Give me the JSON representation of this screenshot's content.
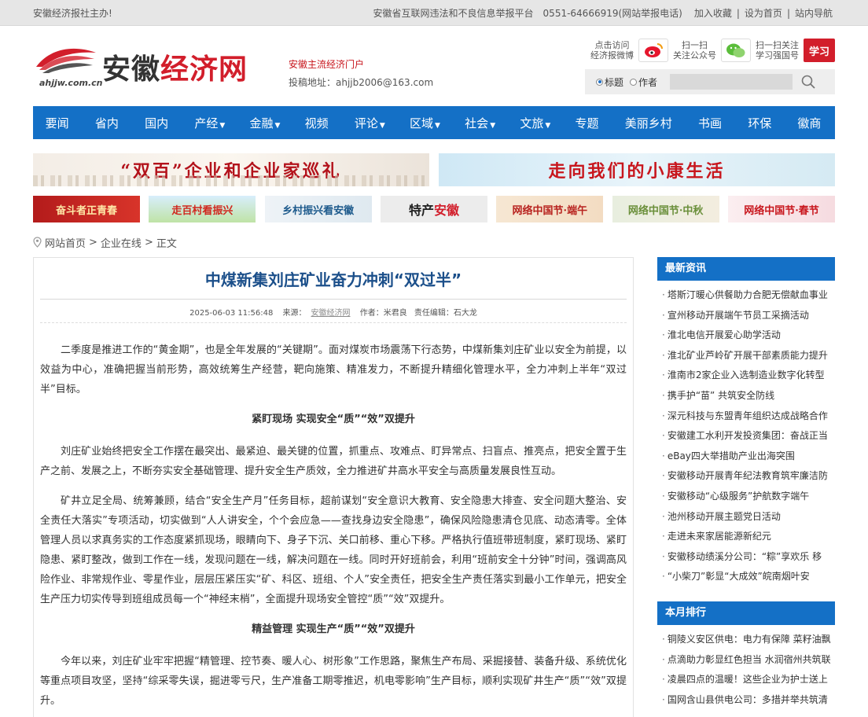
{
  "topbar": {
    "left": "安徽经济报社主办!",
    "report": "安徽省互联网违法和不良信息举报平台",
    "phone": "0551-64666919(网站举报电话)",
    "links": [
      "加入收藏",
      "|",
      "设为首页",
      "|",
      "站内导航"
    ]
  },
  "header": {
    "logo_name_1": "安徽",
    "logo_name_2": "经济网",
    "logo_domain": "ahjjw.com.cn",
    "tagline": "安徽主流经济门户",
    "email": "投稿地址：ahjjb2006@163.com",
    "weibo_text_1": "点击访问",
    "weibo_text_2": "经济报微博",
    "wechat_text_1": "扫一扫",
    "wechat_text_2": "关注公众号",
    "xxq_text_1": "扫一扫关注",
    "xxq_text_2": "学习强国号",
    "xxq_badge": "学习",
    "search_opt_title": "标题",
    "search_opt_author": "作者",
    "search_placeholder": ""
  },
  "nav": [
    {
      "label": "要闻",
      "arrow": ""
    },
    {
      "label": "省内",
      "arrow": ""
    },
    {
      "label": "国内",
      "arrow": ""
    },
    {
      "label": "产经",
      "arrow": "▼"
    },
    {
      "label": "金融",
      "arrow": "▼"
    },
    {
      "label": "视频",
      "arrow": ""
    },
    {
      "label": "评论",
      "arrow": "▼"
    },
    {
      "label": "区域",
      "arrow": "▼"
    },
    {
      "label": "社会",
      "arrow": "▼"
    },
    {
      "label": "文旅",
      "arrow": "▼"
    },
    {
      "label": "专题",
      "arrow": ""
    },
    {
      "label": "美丽乡村",
      "arrow": ""
    },
    {
      "label": "书画",
      "arrow": ""
    },
    {
      "label": "环保",
      "arrow": ""
    },
    {
      "label": "徽商",
      "arrow": ""
    }
  ],
  "banners": {
    "b1": "“双百”企业和企业家巡礼",
    "b2": "走向我们的小康生活",
    "thumbs": [
      "奋斗者正青春",
      "走百村看振兴",
      "乡村振兴看安徽",
      "特产",
      "网络中国节·端午",
      "网络中国节·中秋",
      "网络中国节·春节"
    ],
    "thumb4_red": "安徽"
  },
  "breadcrumb": [
    "网站首页",
    ">",
    "企业在线",
    ">",
    "正文"
  ],
  "article": {
    "title": "中煤新集刘庄矿业奋力冲刺“双过半”",
    "date": "2025-06-03 11:56:48",
    "source_label": "来源：",
    "source": "安徽经济网",
    "author": "作者：米君良",
    "editor": "责任编辑：石大龙",
    "paragraphs": [
      "二季度是推进工作的“黄金期”，也是全年发展的“关键期”。面对煤炭市场震荡下行态势，中煤新集刘庄矿业以安全为前提，以效益为中心，准确把握当前形势，高效统筹生产经营，靶向施策、精准发力，不断提升精细化管理水平，全力冲刺上半年“双过半”目标。",
      "紧盯现场 实现安全“质”“效”双提升",
      "刘庄矿业始终把安全工作摆在最突出、最紧迫、最关键的位置，抓重点、攻难点、盯异常点、扫盲点、推亮点，把安全置于生产之前、发展之上，不断夯实安全基础管理、提升安全生产质效，全力推进矿井高水平安全与高质量发展良性互动。",
      "矿井立足全局、统筹兼顾，结合“安全生产月”任务目标，超前谋划“安全意识大教育、安全隐患大排查、安全问题大整治、安全责任大落实”专项活动，切实做到“人人讲安全，个个会应急——查找身边安全隐患”，确保风险隐患清仓见底、动态清零。全体管理人员以求真务实的工作态度紧抓现场，眼睛向下、身子下沉、关口前移、重心下移。严格执行值班带班制度，紧盯现场、紧盯隐患、紧盯整改，做到工作在一线，发现问题在一线，解决问题在一线。同时开好班前会，利用“班前安全十分钟”时间，强调高风险作业、非常规作业、零星作业，层层压紧压实“矿、科区、班组、个人”安全责任，把安全生产责任落实到最小工作单元，把安全生产压力切实传导到班组成员每一个“神经末梢”，全面提升现场安全管控“质”“效”双提升。",
      "精益管理 实现生产“质”“效”双提升",
      "今年以来，刘庄矿业牢牢把握“精管理、控节奏、暖人心、树形象”工作思路，聚焦生产布局、采掘接替、装备升级、系统优化等重点项目攻坚，坚持“综采零失误，掘进零亏尺，生产准备工期零推迟，机电零影响”生产目标，顺利实现矿井生产“质”“效”双提升。"
    ]
  },
  "sidebar": {
    "latest_title": "最新资讯",
    "latest": [
      "塔斯汀暖心供餐助力合肥无偿献血事业",
      "宣州移动开展端午节员工采摘活动",
      "淮北电信开展爱心助学活动",
      "淮北矿业芦岭矿开展干部素质能力提升",
      "淮南市2家企业入选制造业数字化转型",
      "携手护“苗” 共筑安全防线",
      "深元科技与东盟青年组织达成战略合作",
      "安徽建工水利开发投资集团：奋战正当",
      "eBay四大举措助产业出海突围",
      "安徽移动开展青年纪法教育筑牢廉洁防",
      "安徽移动“心级服务”护航数字端午",
      "池州移动开展主题党日活动",
      "走进未来家居能源新纪元",
      "安徽移动绩溪分公司：“粽”享欢乐 移",
      "“小柴刀”彰显“大成效”皖南烟叶安"
    ],
    "monthly_title": "本月排行",
    "monthly": [
      "铜陵义安区供电：电力有保障 菜籽油飘",
      "点滴助力彰显红色担当 水润宿州共筑联",
      "凌晨四点的温暖！这些企业为护士送上",
      "国网含山县供电公司：多措并举共筑清"
    ]
  }
}
